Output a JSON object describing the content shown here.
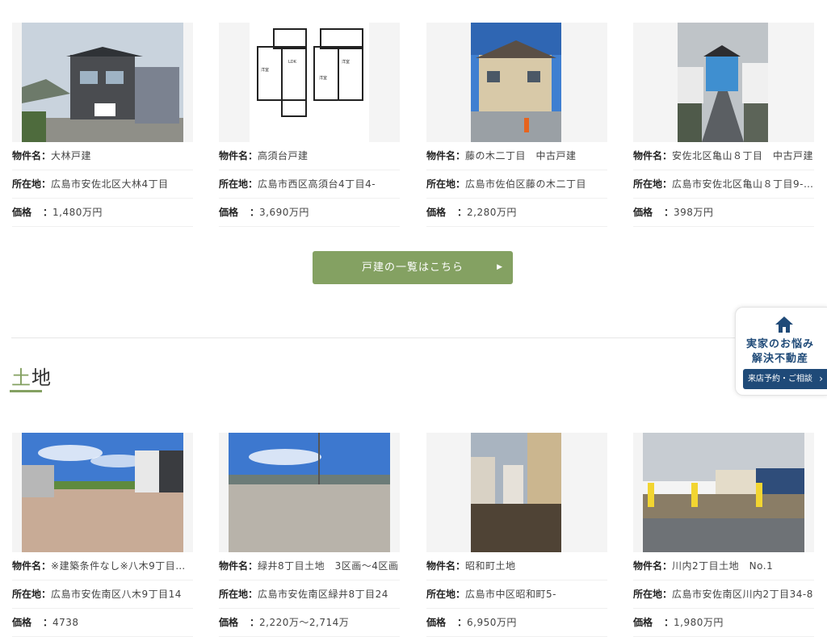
{
  "labels": {
    "name": "物件名",
    "address": "所在地",
    "price": "価格",
    "sep": "："
  },
  "houses": [
    {
      "name": "大林戸建",
      "address": "広島市安佐北区大林4丁目",
      "price": "1,480万円",
      "image": "house-exterior-photo"
    },
    {
      "name": "高須台戸建",
      "address": "広島市西区高須台4丁目4-",
      "price": "3,690万円",
      "image": "floor-plan-image"
    },
    {
      "name": "藤の木二丁目　中古戸建",
      "address": "広島市佐伯区藤の木二丁目",
      "price": "2,280万円",
      "image": "house-exterior-photo"
    },
    {
      "name": "安佐北区亀山８丁目　中古戸建",
      "address": "広島市安佐北区亀山８丁目9-…",
      "price": "398万円",
      "image": "house-street-photo"
    }
  ],
  "houses_button": {
    "label": "戸建の一覧はこちら",
    "icon": "arrow-right-icon"
  },
  "land_section": {
    "title_first": "土",
    "title_rest": "地"
  },
  "lands": [
    {
      "name": "※建築条件なし※八木9丁目…",
      "address": "広島市安佐南区八木9丁目14",
      "price": "4738",
      "image": "land-lot-photo"
    },
    {
      "name": "緑井8丁目土地　3区画～4区画",
      "address": "広島市安佐南区緑井8丁目24",
      "price": "2,220万～2,714万",
      "image": "land-lot-photo"
    },
    {
      "name": "昭和町土地",
      "address": "広島市中区昭和町5-",
      "price": "6,950万円",
      "image": "land-lot-photo"
    },
    {
      "name": "川内2丁目土地　No.1",
      "address": "広島市安佐南区川内2丁目34-8",
      "price": "1,980万円",
      "image": "land-lot-photo"
    }
  ],
  "side_widget": {
    "icon": "house-icon",
    "line1": "実家のお悩み",
    "line2": "解決不動産",
    "button_label": "来店予約・ご相談",
    "button_icon": "chevron-right-icon"
  },
  "colors": {
    "accent": "#84a162",
    "navy": "#1f4a78"
  }
}
